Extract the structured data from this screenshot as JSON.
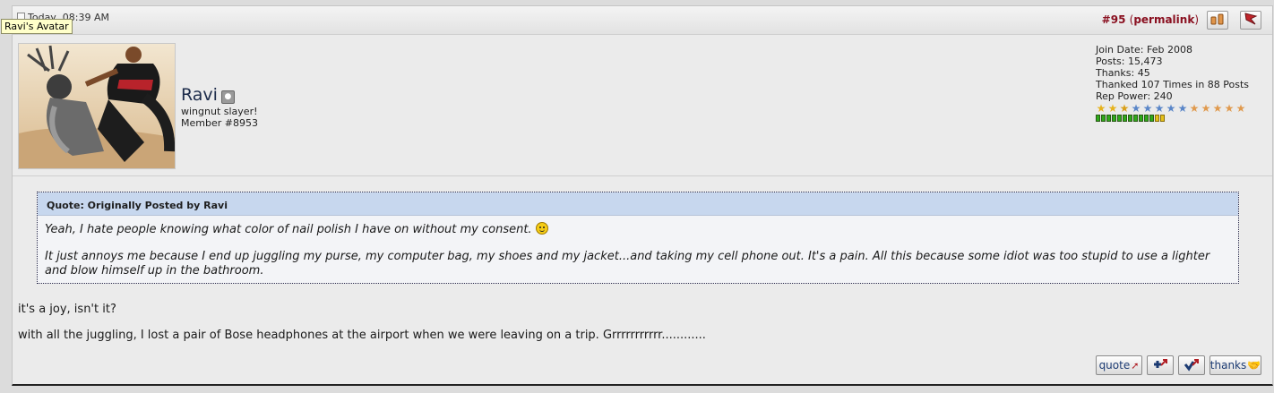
{
  "post": {
    "date": "Today, 08:39 AM",
    "tooltip": "Ravi's Avatar",
    "number": "#95",
    "permalink": "permalink",
    "paren_open": "(",
    "paren_close": ")"
  },
  "user": {
    "name": "Ravi",
    "title": "wingnut slayer!",
    "member_number": "Member #8953",
    "join_date": "Join Date: Feb 2008",
    "posts": "Posts: 15,473",
    "thanks": "Thanks: 45",
    "thanked": "Thanked 107 Times in 88 Posts",
    "rep_power": "Rep Power: 240",
    "rep_stars": 13,
    "rep_bar_segments": 13
  },
  "quote": {
    "header": "Quote: Originally Posted by Ravi",
    "line1": "Yeah, I hate people knowing what color of nail polish I have on without my consent.",
    "line2": "It just annoys me because I end up juggling my purse, my computer bag, my shoes and my jacket...and taking my cell phone out. It's a pain. All this because some idiot was too stupid to use a lighter and blow himself up in the bathroom."
  },
  "message": {
    "p1": "it's a joy, isn't it?",
    "p2": "with all the juggling, I lost a pair of Bose headphones at the airport when we were leaving on a trip. Grrrrrrrrrrr............"
  },
  "buttons": {
    "quote": "quote",
    "thanks": "thanks"
  },
  "colors": {
    "post_number": "#8a1020",
    "quote_header_bg": "#c7d7ee",
    "rep_bar_green": "#2faa1a",
    "rep_bar_end": "#e5c11b"
  }
}
